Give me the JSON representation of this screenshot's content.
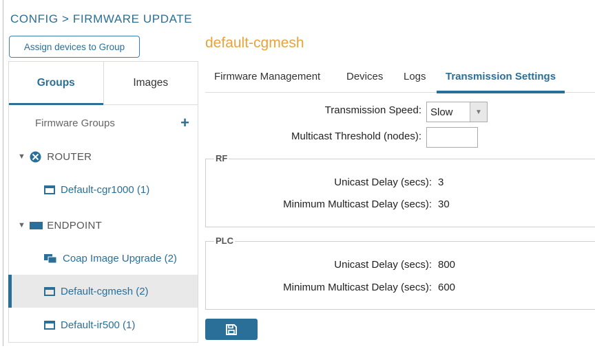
{
  "breadcrumb": "CONFIG > FIRMWARE UPDATE",
  "assign_button": "Assign devices to Group",
  "sidebar": {
    "tabs": [
      {
        "label": "Groups",
        "active": true
      },
      {
        "label": "Images",
        "active": false
      }
    ],
    "section_title": "Firmware Groups",
    "add_icon": "plus-icon",
    "router": {
      "label": "ROUTER",
      "icon": "router-icon",
      "items": [
        {
          "label": "Default-cgr1000 (1)",
          "icon": "window-icon"
        }
      ]
    },
    "endpoint": {
      "label": "ENDPOINT",
      "icon": "endpoint-icon",
      "items": [
        {
          "label": "Coap Image Upgrade (2)",
          "icon": "folder-devices-icon"
        },
        {
          "label": "Default-cgmesh (2)",
          "icon": "window-icon",
          "selected": true
        },
        {
          "label": "Default-ir500 (1)",
          "icon": "window-icon"
        }
      ]
    }
  },
  "main": {
    "title": "default-cgmesh",
    "tabs": [
      {
        "label": "Firmware Management",
        "active": false
      },
      {
        "label": "Devices",
        "active": false
      },
      {
        "label": "Logs",
        "active": false
      },
      {
        "label": "Transmission Settings",
        "active": true
      }
    ],
    "transmission_speed_label": "Transmission Speed:",
    "transmission_speed_value": "Slow",
    "multicast_threshold_label": "Multicast Threshold (nodes):",
    "multicast_threshold_value": "",
    "rf": {
      "legend": "RF",
      "unicast_label": "Unicast Delay (secs):",
      "unicast_value": "3",
      "multicast_label": "Minimum Multicast Delay (secs):",
      "multicast_value": "30"
    },
    "plc": {
      "legend": "PLC",
      "unicast_label": "Unicast Delay (secs):",
      "unicast_value": "800",
      "multicast_label": "Minimum Multicast Delay (secs):",
      "multicast_value": "600"
    },
    "save_icon": "save-icon"
  },
  "colors": {
    "accent": "#2a6f97",
    "title": "#e8a33d",
    "selected_row": "#e9e9e9"
  }
}
